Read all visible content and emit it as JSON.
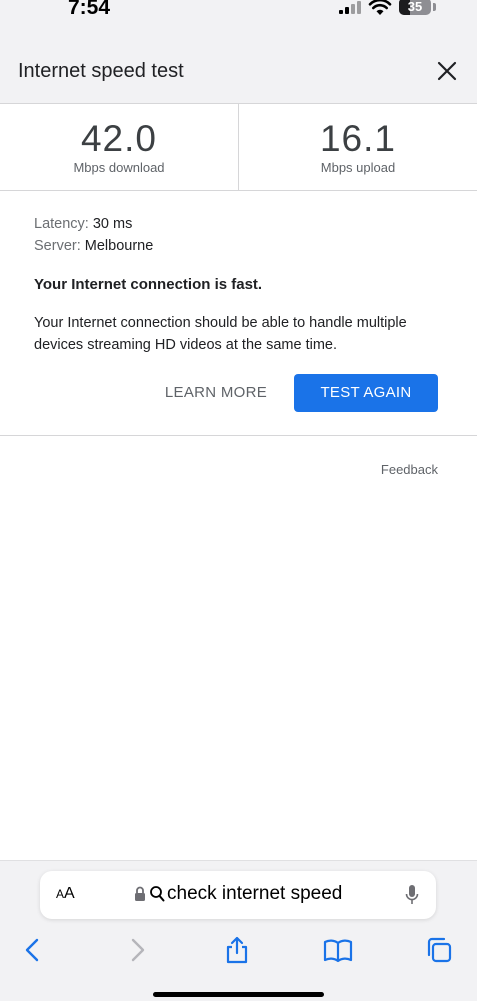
{
  "status": {
    "time": "7:54",
    "battery": "35"
  },
  "header": {
    "title": "Internet speed test"
  },
  "results": {
    "download_value": "42.0",
    "download_unit": "Mbps download",
    "upload_value": "16.1",
    "upload_unit": "Mbps upload",
    "latency_label": "Latency:",
    "latency_value": "30 ms",
    "server_label": "Server:",
    "server_value": "Melbourne",
    "headline": "Your Internet connection is fast.",
    "description": "Your Internet connection should be able to handle multiple devices streaming HD videos at the same time."
  },
  "actions": {
    "learn_more": "LEARN MORE",
    "test_again": "TEST AGAIN",
    "feedback": "Feedback"
  },
  "browser": {
    "aa_small": "A",
    "aa_large": "A",
    "url": "check internet speed"
  },
  "colors": {
    "accent": "#1a73e8",
    "background": "#f2f2f4"
  },
  "icons": [
    "close-icon",
    "lock-icon",
    "search-icon",
    "mic-icon",
    "back-icon",
    "forward-icon",
    "share-icon",
    "bookmarks-icon",
    "tabs-icon",
    "wifi-icon",
    "signal-icon",
    "battery-icon"
  ]
}
